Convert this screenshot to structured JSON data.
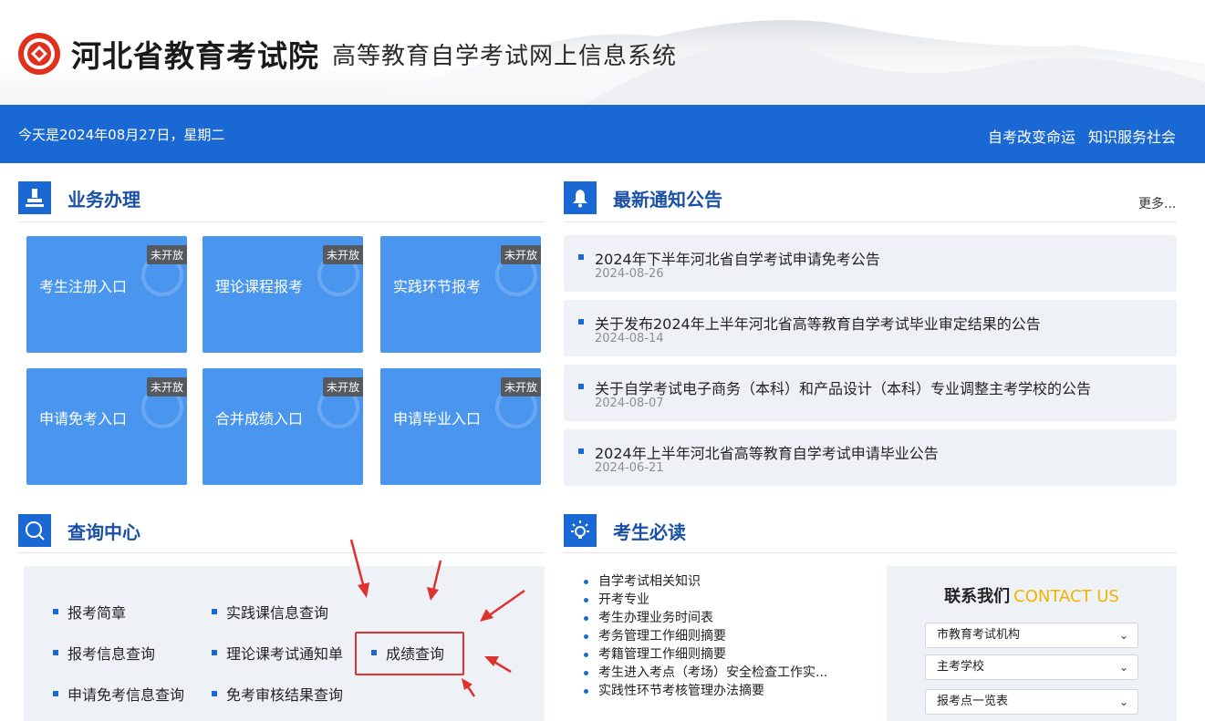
{
  "header": {
    "title": "河北省教育考试院",
    "subtitle": "高等教育自学考试网上信息系统"
  },
  "topbar": {
    "date": "今天是2024年08月27日，星期二",
    "slogan_1": "自考改变命运",
    "slogan_2": "知识服务社会"
  },
  "business": {
    "title": "业务办理",
    "tiles": [
      {
        "label": "考生注册入口",
        "badge": "未开放"
      },
      {
        "label": "理论课程报考",
        "badge": "未开放"
      },
      {
        "label": "实践环节报考",
        "badge": "未开放"
      },
      {
        "label": "申请免考入口",
        "badge": "未开放"
      },
      {
        "label": "合并成绩入口",
        "badge": "未开放"
      },
      {
        "label": "申请毕业入口",
        "badge": "未开放"
      }
    ]
  },
  "notices": {
    "title": "最新通知公告",
    "more": "更多...",
    "items": [
      {
        "title": "2024年下半年河北省自学考试申请免考公告",
        "date": "2024-08-26"
      },
      {
        "title": "关于发布2024年上半年河北省高等教育自学考试毕业审定结果的公告",
        "date": "2024-08-14"
      },
      {
        "title": "关于自学考试电子商务（本科）和产品设计（本科）专业调整主考学校的公告",
        "date": "2024-08-07"
      },
      {
        "title": "2024年上半年河北省高等教育自学考试申请毕业公告",
        "date": "2024-06-21"
      }
    ]
  },
  "query": {
    "title": "查询中心",
    "items": [
      "报考简章",
      "实践课信息查询",
      "报考信息查询",
      "理论课考试通知单",
      "成绩查询",
      "申请免考信息查询",
      "免考审核结果查询"
    ]
  },
  "guide": {
    "title": "考生必读",
    "items": [
      "自学考试相关知识",
      "开考专业",
      "考生办理业务时间表",
      "考务管理工作细则摘要",
      "考籍管理工作细则摘要",
      "考生进入考点（考场）安全检查工作实...",
      "实践性环节考核管理办法摘要"
    ]
  },
  "contact": {
    "title_cn": "联系我们",
    "title_en": "CONTACT US",
    "selects": [
      "市教育考试机构",
      "主考学校",
      "报考点一览表"
    ]
  },
  "colors": {
    "brand_blue": "#1a68d4",
    "tile_blue": "#4a96ef",
    "panel_bg": "#eef2f7",
    "highlight_red": "#e03131",
    "accent_yellow": "#f0b400"
  }
}
